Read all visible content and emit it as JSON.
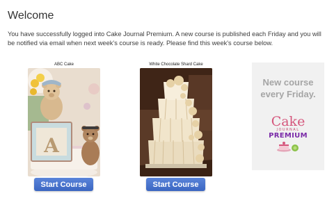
{
  "page": {
    "heading": "Welcome",
    "intro": "You have successfully logged into Cake Journal Premium. A new course is published each Friday and you will be notified via email when next week's course is ready. Please find this week's course below."
  },
  "courses": [
    {
      "title": "ABC Cake",
      "button_label": "Start Course"
    },
    {
      "title": "White Chocolate Shard Cake",
      "button_label": "Start Course"
    }
  ],
  "promo": {
    "line1": "New course",
    "line2": "every Friday.",
    "logo": {
      "word1": "Cake",
      "word2": "JOURNAL",
      "word3": "PREMIUM"
    }
  },
  "colors": {
    "button": "#4a76cf",
    "promo_bg": "#f1f1f1",
    "promo_text": "#a5a5a5",
    "logo_pink": "#d5567c",
    "logo_purple": "#7a2aa8"
  }
}
